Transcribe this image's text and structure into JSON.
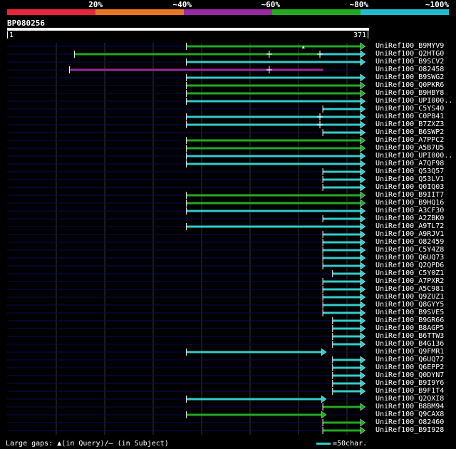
{
  "legend": {
    "labels": [
      "20%",
      "~40%",
      "~60%",
      "~80%",
      "~100%"
    ],
    "colors": [
      "#e8263a",
      "#e87722",
      "#992aa2",
      "#22aa22",
      "#22bbcc"
    ]
  },
  "query": {
    "name": "BP080256",
    "start": "1",
    "end": "371"
  },
  "colors": {
    "green": "#22aa22",
    "cyan": "#33cccc",
    "purple": "#992aa2",
    "navy": "#0a0a55",
    "grid": "#333333"
  },
  "chart_data": {
    "type": "alignment-overview",
    "axis": {
      "min": 1,
      "max": 371
    },
    "hits": [
      {
        "name": "UniRef100_B9MYV9",
        "segments": [
          {
            "from": 185,
            "to": 365,
            "color": "green"
          }
        ],
        "gap": "query"
      },
      {
        "name": "UniRef100_Q2HTG0",
        "segments": [
          {
            "from": 70,
            "to": 270,
            "color": "green"
          },
          {
            "from": 270,
            "to": 322,
            "color": "green"
          },
          {
            "from": 322,
            "to": 365,
            "color": "cyan"
          }
        ]
      },
      {
        "name": "UniRef100_B9SCV2",
        "segments": [
          {
            "from": 185,
            "to": 365,
            "color": "cyan"
          }
        ]
      },
      {
        "name": "UniRef100_O82458",
        "segments": [
          {
            "from": 65,
            "to": 270,
            "color": "purple"
          },
          {
            "from": 270,
            "to": 325,
            "color": "purple"
          }
        ]
      },
      {
        "name": "UniRef100_B9SWG2",
        "segments": [
          {
            "from": 185,
            "to": 365,
            "color": "cyan"
          }
        ]
      },
      {
        "name": "UniRef100_Q0PKR6",
        "segments": [
          {
            "from": 185,
            "to": 365,
            "color": "green"
          }
        ]
      },
      {
        "name": "UniRef100_B9HBY8",
        "segments": [
          {
            "from": 185,
            "to": 365,
            "color": "green"
          }
        ]
      },
      {
        "name": "UniRef100_UPI000..",
        "segments": [
          {
            "from": 185,
            "to": 365,
            "color": "cyan"
          }
        ]
      },
      {
        "name": "UniRef100_C5YS40",
        "segments": [
          {
            "from": 325,
            "to": 365,
            "color": "cyan"
          }
        ]
      },
      {
        "name": "UniRef100_C0P841",
        "segments": [
          {
            "from": 185,
            "to": 322,
            "color": "cyan"
          },
          {
            "from": 322,
            "to": 365,
            "color": "cyan"
          }
        ]
      },
      {
        "name": "UniRef100_B7ZXZ3",
        "segments": [
          {
            "from": 185,
            "to": 322,
            "color": "cyan"
          },
          {
            "from": 322,
            "to": 365,
            "color": "cyan"
          }
        ]
      },
      {
        "name": "UniRef100_B6SWP2",
        "segments": [
          {
            "from": 325,
            "to": 365,
            "color": "cyan"
          }
        ]
      },
      {
        "name": "UniRef100_A7PPC2",
        "segments": [
          {
            "from": 185,
            "to": 365,
            "color": "green"
          }
        ]
      },
      {
        "name": "UniRef100_A5B7U5",
        "segments": [
          {
            "from": 185,
            "to": 365,
            "color": "green"
          }
        ]
      },
      {
        "name": "UniRef100_UPI000..",
        "segments": [
          {
            "from": 185,
            "to": 365,
            "color": "cyan"
          }
        ]
      },
      {
        "name": "UniRef100_A7QF98",
        "segments": [
          {
            "from": 185,
            "to": 365,
            "color": "cyan"
          }
        ]
      },
      {
        "name": "UniRef100_Q53Q57",
        "segments": [
          {
            "from": 325,
            "to": 365,
            "color": "cyan"
          }
        ]
      },
      {
        "name": "UniRef100_Q53LV1",
        "segments": [
          {
            "from": 325,
            "to": 365,
            "color": "cyan"
          }
        ]
      },
      {
        "name": "UniRef100_Q0IQ03",
        "segments": [
          {
            "from": 325,
            "to": 365,
            "color": "cyan"
          }
        ]
      },
      {
        "name": "UniRef100_B9IIT7",
        "segments": [
          {
            "from": 185,
            "to": 365,
            "color": "green"
          }
        ]
      },
      {
        "name": "UniRef100_B9HQ16",
        "segments": [
          {
            "from": 185,
            "to": 365,
            "color": "green"
          }
        ]
      },
      {
        "name": "UniRef100_A3CF30",
        "segments": [
          {
            "from": 185,
            "to": 365,
            "color": "cyan"
          }
        ]
      },
      {
        "name": "UniRef100_A2ZBK0",
        "segments": [
          {
            "from": 325,
            "to": 365,
            "color": "cyan"
          }
        ]
      },
      {
        "name": "UniRef100_A9TL72",
        "segments": [
          {
            "from": 185,
            "to": 365,
            "color": "cyan"
          }
        ]
      },
      {
        "name": "UniRef100_A9RJV1",
        "segments": [
          {
            "from": 325,
            "to": 365,
            "color": "cyan"
          }
        ]
      },
      {
        "name": "UniRef100_O82459",
        "segments": [
          {
            "from": 325,
            "to": 365,
            "color": "cyan"
          }
        ]
      },
      {
        "name": "UniRef100_C5Y4Z8",
        "segments": [
          {
            "from": 325,
            "to": 365,
            "color": "cyan"
          }
        ]
      },
      {
        "name": "UniRef100_Q6UQ73",
        "segments": [
          {
            "from": 325,
            "to": 365,
            "color": "cyan"
          }
        ]
      },
      {
        "name": "UniRef100_Q2QPD6",
        "segments": [
          {
            "from": 325,
            "to": 365,
            "color": "cyan"
          }
        ]
      },
      {
        "name": "UniRef100_C5Y0Z1",
        "segments": [
          {
            "from": 335,
            "to": 365,
            "color": "cyan"
          }
        ]
      },
      {
        "name": "UniRef100_A7PXR2",
        "segments": [
          {
            "from": 325,
            "to": 365,
            "color": "cyan"
          }
        ]
      },
      {
        "name": "UniRef100_A5C981",
        "segments": [
          {
            "from": 325,
            "to": 365,
            "color": "cyan"
          }
        ]
      },
      {
        "name": "UniRef100_Q9ZUZ1",
        "segments": [
          {
            "from": 325,
            "to": 365,
            "color": "cyan"
          }
        ]
      },
      {
        "name": "UniRef100_Q8GYY5",
        "segments": [
          {
            "from": 325,
            "to": 365,
            "color": "cyan"
          }
        ]
      },
      {
        "name": "UniRef100_B9SVE5",
        "segments": [
          {
            "from": 325,
            "to": 365,
            "color": "cyan"
          }
        ]
      },
      {
        "name": "UniRef100_B9GR66",
        "segments": [
          {
            "from": 335,
            "to": 365,
            "color": "cyan"
          }
        ]
      },
      {
        "name": "UniRef100_B8AGP5",
        "segments": [
          {
            "from": 335,
            "to": 365,
            "color": "cyan"
          }
        ]
      },
      {
        "name": "UniRef100_B6TTW3",
        "segments": [
          {
            "from": 335,
            "to": 365,
            "color": "cyan"
          }
        ]
      },
      {
        "name": "UniRef100_B4G136",
        "segments": [
          {
            "from": 335,
            "to": 365,
            "color": "cyan"
          }
        ]
      },
      {
        "name": "UniRef100_Q9FMR1",
        "segments": [
          {
            "from": 185,
            "to": 325,
            "color": "cyan"
          }
        ]
      },
      {
        "name": "UniRef100_Q6UQ72",
        "segments": [
          {
            "from": 335,
            "to": 365,
            "color": "cyan"
          }
        ]
      },
      {
        "name": "UniRef100_Q6EPP2",
        "segments": [
          {
            "from": 335,
            "to": 365,
            "color": "cyan"
          }
        ]
      },
      {
        "name": "UniRef100_Q0DYN7",
        "segments": [
          {
            "from": 335,
            "to": 365,
            "color": "cyan"
          }
        ]
      },
      {
        "name": "UniRef100_B9I9Y6",
        "segments": [
          {
            "from": 335,
            "to": 365,
            "color": "cyan"
          }
        ]
      },
      {
        "name": "UniRef100_B9F1T4",
        "segments": [
          {
            "from": 335,
            "to": 365,
            "color": "cyan"
          }
        ]
      },
      {
        "name": "UniRef100_Q2QXI8",
        "segments": [
          {
            "from": 185,
            "to": 325,
            "color": "cyan"
          }
        ]
      },
      {
        "name": "UniRef100_B8BM94",
        "segments": [
          {
            "from": 325,
            "to": 365,
            "color": "green"
          }
        ]
      },
      {
        "name": "UniRef100_Q9CAX8",
        "segments": [
          {
            "from": 185,
            "to": 325,
            "color": "green"
          }
        ]
      },
      {
        "name": "UniRef100_O82460",
        "segments": [
          {
            "from": 325,
            "to": 365,
            "color": "green"
          }
        ]
      },
      {
        "name": "UniRef100_B9I928",
        "segments": [
          {
            "from": 325,
            "to": 365,
            "color": "green"
          }
        ]
      }
    ]
  },
  "footer": {
    "gaps_label": "Large gaps:",
    "query_symbol": "▲",
    "query_text": "(in Query)/",
    "subject_symbol": "–",
    "subject_text": " (in Subject)",
    "scale_text": "=50char."
  }
}
